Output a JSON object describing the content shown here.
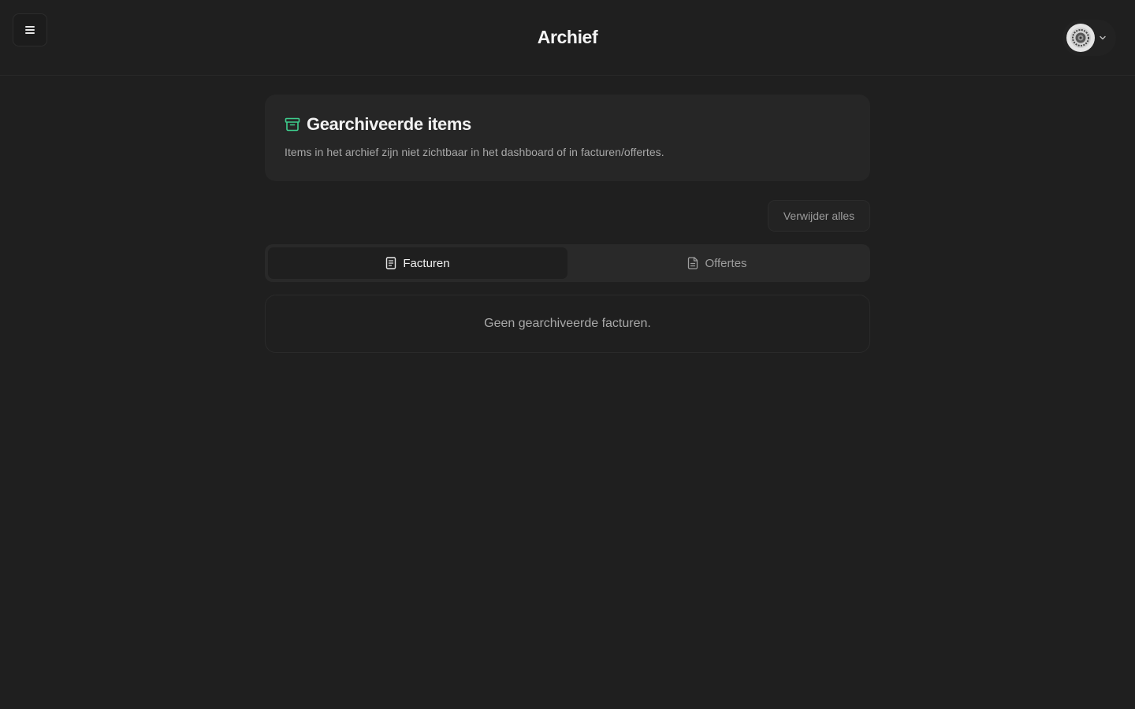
{
  "header": {
    "title": "Archief",
    "menu_icon": "hamburger-icon",
    "user_menu": {
      "avatar_icon": "avatar-logo-icon",
      "chevron_icon": "chevron-down-icon"
    }
  },
  "info_card": {
    "icon": "archive-box-icon",
    "title": "Gearchiveerde items",
    "description": "Items in het archief zijn niet zichtbaar in het dashboard of in facturen/offertes."
  },
  "actions": {
    "delete_all_label": "Verwijder alles"
  },
  "tabs": [
    {
      "label": "Facturen",
      "icon": "invoice-icon",
      "active": true
    },
    {
      "label": "Offertes",
      "icon": "document-icon",
      "active": false
    }
  ],
  "empty_state": {
    "text": "Geen gearchiveerde facturen."
  },
  "colors": {
    "background": "#1f1f1f",
    "card": "#262626",
    "accent": "#3ecf8e",
    "text_primary": "#f2f2f2",
    "text_muted": "#a8a8a8"
  }
}
